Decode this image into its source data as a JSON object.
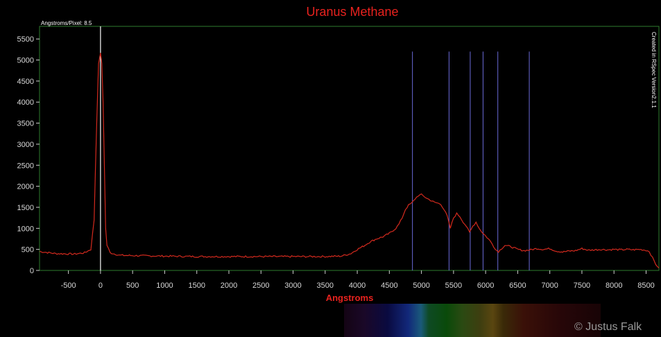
{
  "chart_data": {
    "type": "line",
    "title": "Uranus Methane",
    "xlabel": "Angstroms",
    "ylabel": "",
    "xlim": [
      -950,
      8700
    ],
    "ylim": [
      0,
      5800
    ],
    "x_ticks": [
      -500,
      0,
      500,
      1000,
      1500,
      2000,
      2500,
      3000,
      3500,
      4000,
      4500,
      5000,
      5500,
      6000,
      6500,
      7000,
      7500,
      8000,
      8500
    ],
    "y_ticks": [
      0,
      500,
      1000,
      1500,
      2000,
      2500,
      3000,
      3500,
      4000,
      4500,
      5000,
      5500
    ],
    "annotations": {
      "dispersion": "Angstroms/Pixel: 8.5",
      "software": "Created in RSpec Version2.1.1",
      "credit": "© Justus Falk"
    },
    "zero_marker_x": 0,
    "reference_lines_x": [
      4860,
      5430,
      5760,
      5960,
      6190,
      6680
    ],
    "series": [
      {
        "color": "#d42a1e",
        "x": [
          -950,
          -700,
          -400,
          -250,
          -150,
          -100,
          -60,
          -30,
          0,
          20,
          40,
          60,
          80,
          100,
          150,
          300,
          600,
          1000,
          1500,
          2000,
          2500,
          3000,
          3500,
          3750,
          3900,
          4000,
          4100,
          4200,
          4300,
          4400,
          4500,
          4600,
          4650,
          4700,
          4750,
          4800,
          4850,
          4900,
          4950,
          5000,
          5050,
          5100,
          5200,
          5300,
          5350,
          5400,
          5450,
          5500,
          5550,
          5600,
          5650,
          5700,
          5750,
          5800,
          5850,
          5900,
          5950,
          6000,
          6100,
          6150,
          6200,
          6250,
          6300,
          6400,
          6500,
          6600,
          6700,
          6800,
          6900,
          7000,
          7100,
          7200,
          7300,
          7400,
          7500,
          7600,
          7700,
          7800,
          7900,
          8000,
          8100,
          8200,
          8300,
          8400,
          8500,
          8550,
          8600,
          8650,
          8700
        ],
        "y": [
          450,
          400,
          390,
          420,
          500,
          1200,
          3500,
          4900,
          5180,
          4900,
          4000,
          2500,
          1000,
          600,
          420,
          360,
          350,
          340,
          330,
          330,
          330,
          330,
          330,
          340,
          400,
          500,
          580,
          680,
          750,
          800,
          880,
          1000,
          1100,
          1250,
          1450,
          1550,
          1600,
          1700,
          1780,
          1800,
          1750,
          1700,
          1620,
          1580,
          1450,
          1300,
          1000,
          1250,
          1350,
          1280,
          1150,
          1050,
          900,
          1050,
          1150,
          1000,
          900,
          820,
          650,
          500,
          450,
          520,
          600,
          560,
          500,
          470,
          490,
          520,
          500,
          520,
          460,
          440,
          460,
          470,
          520,
          480,
          490,
          500,
          490,
          500,
          490,
          500,
          490,
          500,
          480,
          450,
          300,
          150,
          60
        ]
      }
    ]
  }
}
